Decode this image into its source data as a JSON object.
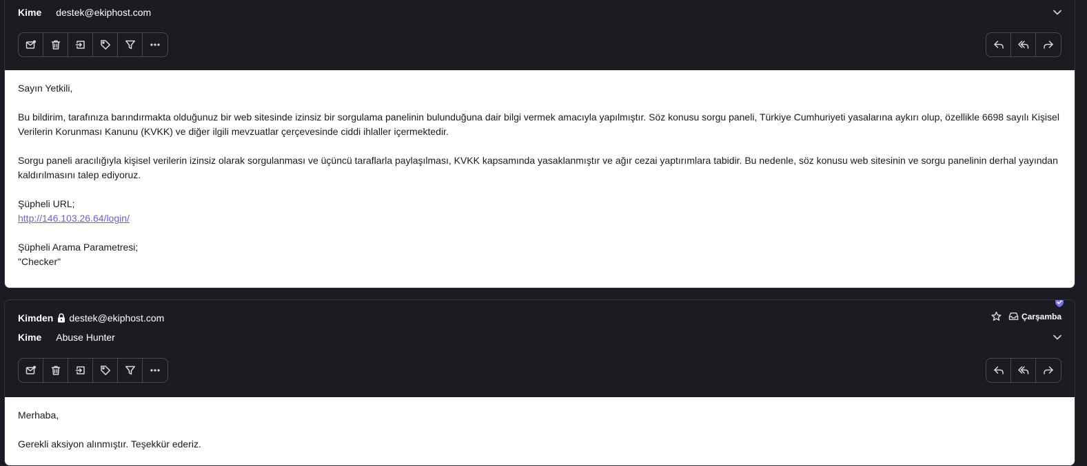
{
  "messages": [
    {
      "to_label": "Kime",
      "to_value": "destek@ekiphost.com",
      "body": {
        "greeting": "Sayın Yetkili,",
        "paragraph1": "Bu bildirim, tarafınıza barındırmakta olduğunuz bir web sitesinde izinsiz bir sorgulama panelinin bulunduğuna dair bilgi vermek amacıyla yapılmıştır. Söz konusu sorgu paneli, Türkiye Cumhuriyeti yasalarına aykırı olup, özellikle 6698 sayılı Kişisel Verilerin Korunması Kanunu (KVKK) ve diğer ilgili mevzuatlar çerçevesinde ciddi ihlaller içermektedir.",
        "paragraph2": "Sorgu paneli aracılığıyla kişisel verilerin izinsiz olarak sorgulanması ve üçüncü taraflarla paylaşılması, KVKK kapsamında yasaklanmıştır ve ağır cezai yaptırımlara tabidir. Bu nedenle, söz konusu web sitesinin ve sorgu panelinin derhal yayından kaldırılmasını talep ediyoruz.",
        "url_label": "Şüpheli URL;",
        "url": "http://146.103.26.64/login/",
        "param_label": "Şüpheli Arama Parametresi;",
        "param_value": "\"Checker\""
      }
    },
    {
      "from_label": "Kimden",
      "from_value": "destek@ekiphost.com",
      "to_label": "Kime",
      "to_value": "Abuse Hunter",
      "date": "Çarşamba",
      "body": {
        "greeting": "Merhaba,",
        "line1": "Gerekli aksiyon alınmıştır. Teşekkür ederiz."
      }
    }
  ],
  "icons": {
    "left_toolbar": [
      "mark-unread-icon",
      "trash-icon",
      "move-to-folder-icon",
      "label-tag-icon",
      "filter-icon",
      "more-icon"
    ],
    "right_toolbar": [
      "reply-icon",
      "reply-all-icon",
      "forward-icon"
    ]
  },
  "colors": {
    "background": "#1b1b22",
    "link": "#6a5fd8",
    "verified_badge": "#7b6ef0"
  }
}
